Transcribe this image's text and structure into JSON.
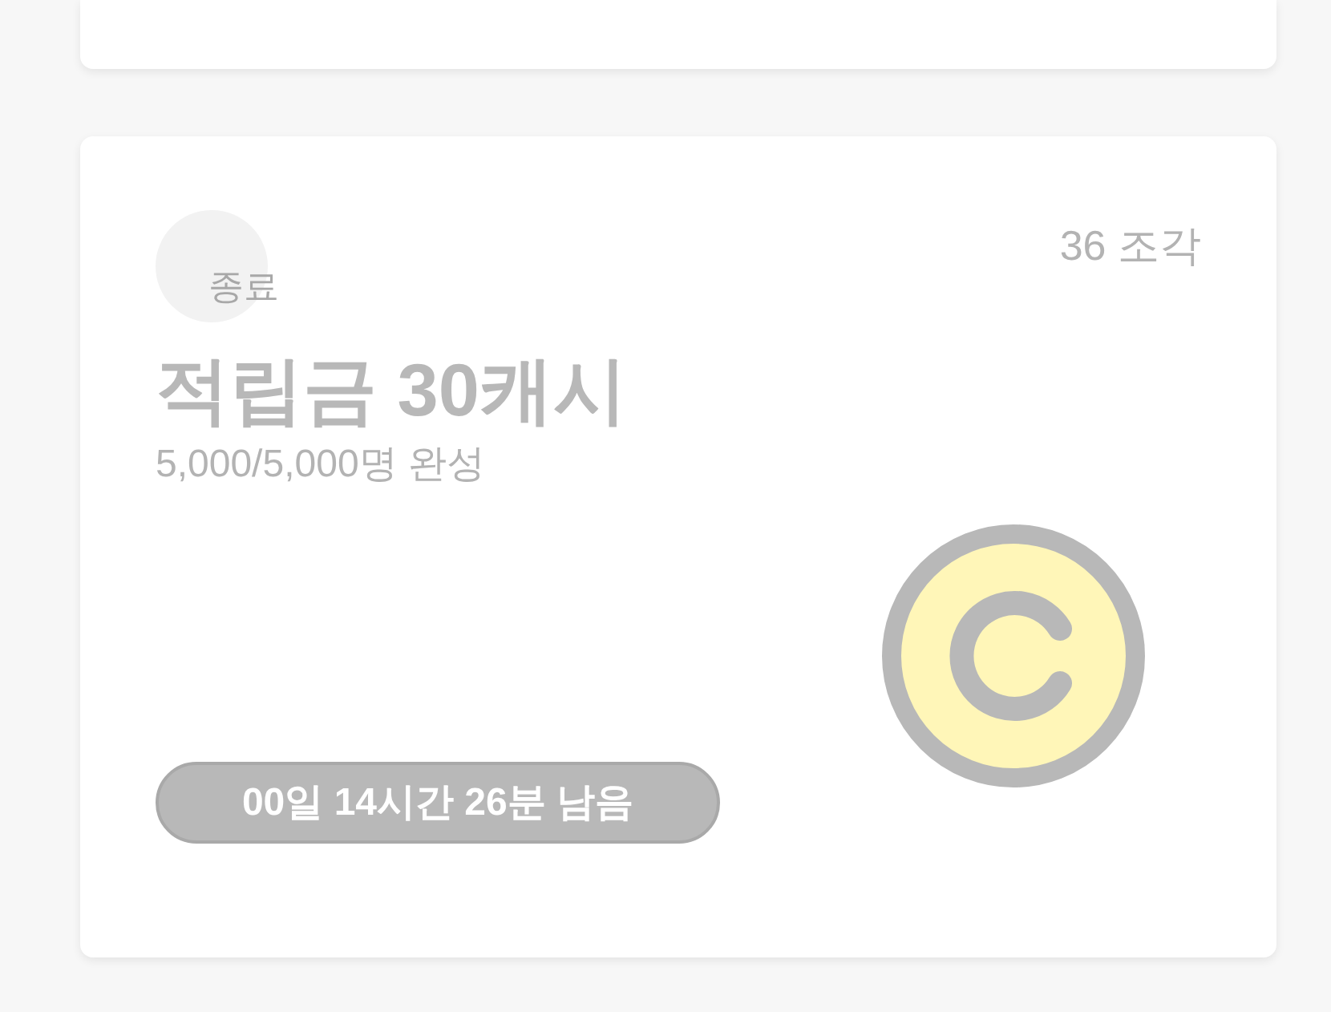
{
  "card": {
    "status": "종료",
    "pieces": "36 조각",
    "title": "적립금 30캐시",
    "progress": "5,000/5,000명 완성",
    "time_left": "00일 14시간 26분 남음"
  }
}
